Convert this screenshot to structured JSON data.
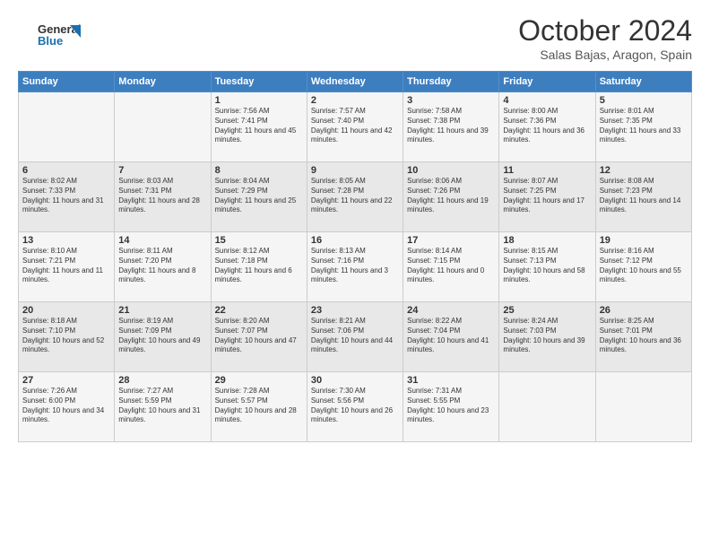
{
  "header": {
    "logo_general": "General",
    "logo_blue": "Blue",
    "title": "October 2024",
    "location": "Salas Bajas, Aragon, Spain"
  },
  "weekdays": [
    "Sunday",
    "Monday",
    "Tuesday",
    "Wednesday",
    "Thursday",
    "Friday",
    "Saturday"
  ],
  "weeks": [
    [
      {
        "day": "",
        "sunrise": "",
        "sunset": "",
        "daylight": ""
      },
      {
        "day": "",
        "sunrise": "",
        "sunset": "",
        "daylight": ""
      },
      {
        "day": "1",
        "sunrise": "Sunrise: 7:56 AM",
        "sunset": "Sunset: 7:41 PM",
        "daylight": "Daylight: 11 hours and 45 minutes."
      },
      {
        "day": "2",
        "sunrise": "Sunrise: 7:57 AM",
        "sunset": "Sunset: 7:40 PM",
        "daylight": "Daylight: 11 hours and 42 minutes."
      },
      {
        "day": "3",
        "sunrise": "Sunrise: 7:58 AM",
        "sunset": "Sunset: 7:38 PM",
        "daylight": "Daylight: 11 hours and 39 minutes."
      },
      {
        "day": "4",
        "sunrise": "Sunrise: 8:00 AM",
        "sunset": "Sunset: 7:36 PM",
        "daylight": "Daylight: 11 hours and 36 minutes."
      },
      {
        "day": "5",
        "sunrise": "Sunrise: 8:01 AM",
        "sunset": "Sunset: 7:35 PM",
        "daylight": "Daylight: 11 hours and 33 minutes."
      }
    ],
    [
      {
        "day": "6",
        "sunrise": "Sunrise: 8:02 AM",
        "sunset": "Sunset: 7:33 PM",
        "daylight": "Daylight: 11 hours and 31 minutes."
      },
      {
        "day": "7",
        "sunrise": "Sunrise: 8:03 AM",
        "sunset": "Sunset: 7:31 PM",
        "daylight": "Daylight: 11 hours and 28 minutes."
      },
      {
        "day": "8",
        "sunrise": "Sunrise: 8:04 AM",
        "sunset": "Sunset: 7:29 PM",
        "daylight": "Daylight: 11 hours and 25 minutes."
      },
      {
        "day": "9",
        "sunrise": "Sunrise: 8:05 AM",
        "sunset": "Sunset: 7:28 PM",
        "daylight": "Daylight: 11 hours and 22 minutes."
      },
      {
        "day": "10",
        "sunrise": "Sunrise: 8:06 AM",
        "sunset": "Sunset: 7:26 PM",
        "daylight": "Daylight: 11 hours and 19 minutes."
      },
      {
        "day": "11",
        "sunrise": "Sunrise: 8:07 AM",
        "sunset": "Sunset: 7:25 PM",
        "daylight": "Daylight: 11 hours and 17 minutes."
      },
      {
        "day": "12",
        "sunrise": "Sunrise: 8:08 AM",
        "sunset": "Sunset: 7:23 PM",
        "daylight": "Daylight: 11 hours and 14 minutes."
      }
    ],
    [
      {
        "day": "13",
        "sunrise": "Sunrise: 8:10 AM",
        "sunset": "Sunset: 7:21 PM",
        "daylight": "Daylight: 11 hours and 11 minutes."
      },
      {
        "day": "14",
        "sunrise": "Sunrise: 8:11 AM",
        "sunset": "Sunset: 7:20 PM",
        "daylight": "Daylight: 11 hours and 8 minutes."
      },
      {
        "day": "15",
        "sunrise": "Sunrise: 8:12 AM",
        "sunset": "Sunset: 7:18 PM",
        "daylight": "Daylight: 11 hours and 6 minutes."
      },
      {
        "day": "16",
        "sunrise": "Sunrise: 8:13 AM",
        "sunset": "Sunset: 7:16 PM",
        "daylight": "Daylight: 11 hours and 3 minutes."
      },
      {
        "day": "17",
        "sunrise": "Sunrise: 8:14 AM",
        "sunset": "Sunset: 7:15 PM",
        "daylight": "Daylight: 11 hours and 0 minutes."
      },
      {
        "day": "18",
        "sunrise": "Sunrise: 8:15 AM",
        "sunset": "Sunset: 7:13 PM",
        "daylight": "Daylight: 10 hours and 58 minutes."
      },
      {
        "day": "19",
        "sunrise": "Sunrise: 8:16 AM",
        "sunset": "Sunset: 7:12 PM",
        "daylight": "Daylight: 10 hours and 55 minutes."
      }
    ],
    [
      {
        "day": "20",
        "sunrise": "Sunrise: 8:18 AM",
        "sunset": "Sunset: 7:10 PM",
        "daylight": "Daylight: 10 hours and 52 minutes."
      },
      {
        "day": "21",
        "sunrise": "Sunrise: 8:19 AM",
        "sunset": "Sunset: 7:09 PM",
        "daylight": "Daylight: 10 hours and 49 minutes."
      },
      {
        "day": "22",
        "sunrise": "Sunrise: 8:20 AM",
        "sunset": "Sunset: 7:07 PM",
        "daylight": "Daylight: 10 hours and 47 minutes."
      },
      {
        "day": "23",
        "sunrise": "Sunrise: 8:21 AM",
        "sunset": "Sunset: 7:06 PM",
        "daylight": "Daylight: 10 hours and 44 minutes."
      },
      {
        "day": "24",
        "sunrise": "Sunrise: 8:22 AM",
        "sunset": "Sunset: 7:04 PM",
        "daylight": "Daylight: 10 hours and 41 minutes."
      },
      {
        "day": "25",
        "sunrise": "Sunrise: 8:24 AM",
        "sunset": "Sunset: 7:03 PM",
        "daylight": "Daylight: 10 hours and 39 minutes."
      },
      {
        "day": "26",
        "sunrise": "Sunrise: 8:25 AM",
        "sunset": "Sunset: 7:01 PM",
        "daylight": "Daylight: 10 hours and 36 minutes."
      }
    ],
    [
      {
        "day": "27",
        "sunrise": "Sunrise: 7:26 AM",
        "sunset": "Sunset: 6:00 PM",
        "daylight": "Daylight: 10 hours and 34 minutes."
      },
      {
        "day": "28",
        "sunrise": "Sunrise: 7:27 AM",
        "sunset": "Sunset: 5:59 PM",
        "daylight": "Daylight: 10 hours and 31 minutes."
      },
      {
        "day": "29",
        "sunrise": "Sunrise: 7:28 AM",
        "sunset": "Sunset: 5:57 PM",
        "daylight": "Daylight: 10 hours and 28 minutes."
      },
      {
        "day": "30",
        "sunrise": "Sunrise: 7:30 AM",
        "sunset": "Sunset: 5:56 PM",
        "daylight": "Daylight: 10 hours and 26 minutes."
      },
      {
        "day": "31",
        "sunrise": "Sunrise: 7:31 AM",
        "sunset": "Sunset: 5:55 PM",
        "daylight": "Daylight: 10 hours and 23 minutes."
      },
      {
        "day": "",
        "sunrise": "",
        "sunset": "",
        "daylight": ""
      },
      {
        "day": "",
        "sunrise": "",
        "sunset": "",
        "daylight": ""
      }
    ]
  ]
}
